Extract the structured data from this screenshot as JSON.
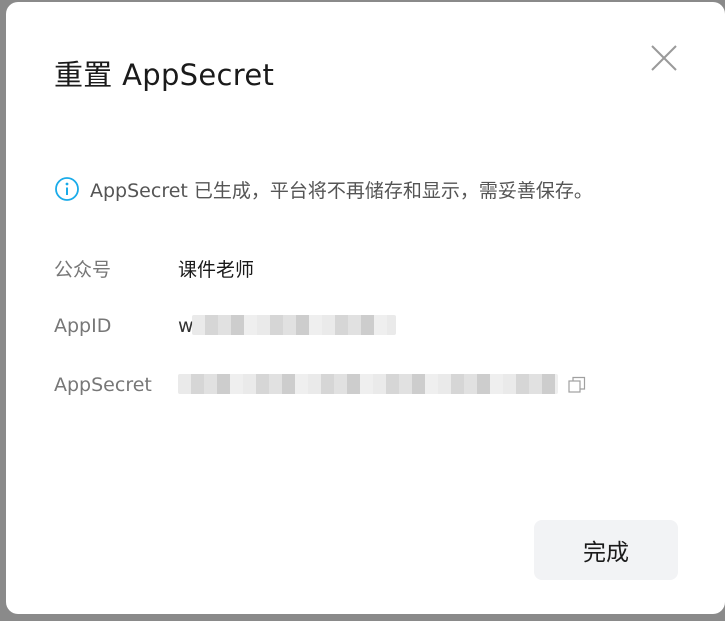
{
  "dialog": {
    "title": "重置 AppSecret",
    "close_icon": "close-icon",
    "info": {
      "icon": "info-icon",
      "icon_color": "#1aabe9",
      "text": "AppSecret 已生成，平台将不再储存和显示，需妥善保存。"
    },
    "fields": [
      {
        "label": "公众号",
        "value": "课件老师"
      },
      {
        "label": "AppID",
        "value_prefix": "w",
        "value_redacted": true
      },
      {
        "label": "AppSecret",
        "value_redacted": true,
        "copy_icon": "copy-icon"
      }
    ],
    "done_label": "完成"
  }
}
